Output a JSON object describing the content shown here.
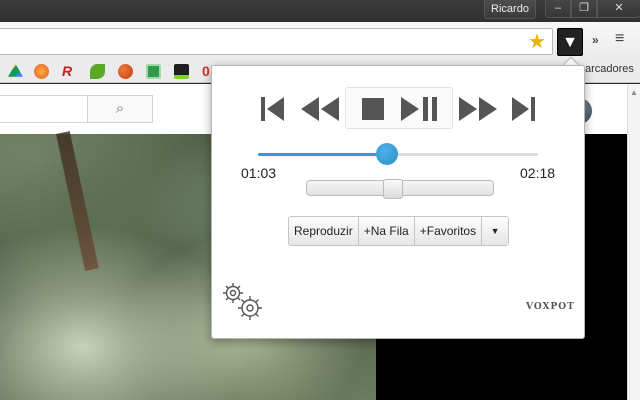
{
  "window": {
    "profile_name": "Ricardo",
    "controls": {
      "minimize": "–",
      "restore": "❐",
      "close": "✕"
    }
  },
  "toolbar": {
    "star_icon": "star-icon",
    "extension_icon": "▼",
    "overflow": "»",
    "menu": "≡"
  },
  "bookmarks": {
    "folder_label": "arcadores",
    "colors": [
      "#3a7bd5",
      "#e2572c",
      "#d11c1c",
      "#5ba829",
      "#d94e1f",
      "#2e9c4c",
      "#1f1f1f",
      "#d82c2c"
    ]
  },
  "page": {
    "search_icon": "🔍"
  },
  "player": {
    "controls": [
      "previous",
      "rewind",
      "stop",
      "play-pause",
      "fast-forward",
      "next"
    ],
    "progress": 0.462,
    "current_time": "01:03",
    "total_time": "02:18",
    "volume": 0.455,
    "buttons": {
      "play": "Reproduzir",
      "queue": "+Na Fila",
      "favorites": "+Favoritos",
      "more": "▼"
    },
    "brand": "VOXPOT",
    "accent_color": "#3b98cf"
  }
}
